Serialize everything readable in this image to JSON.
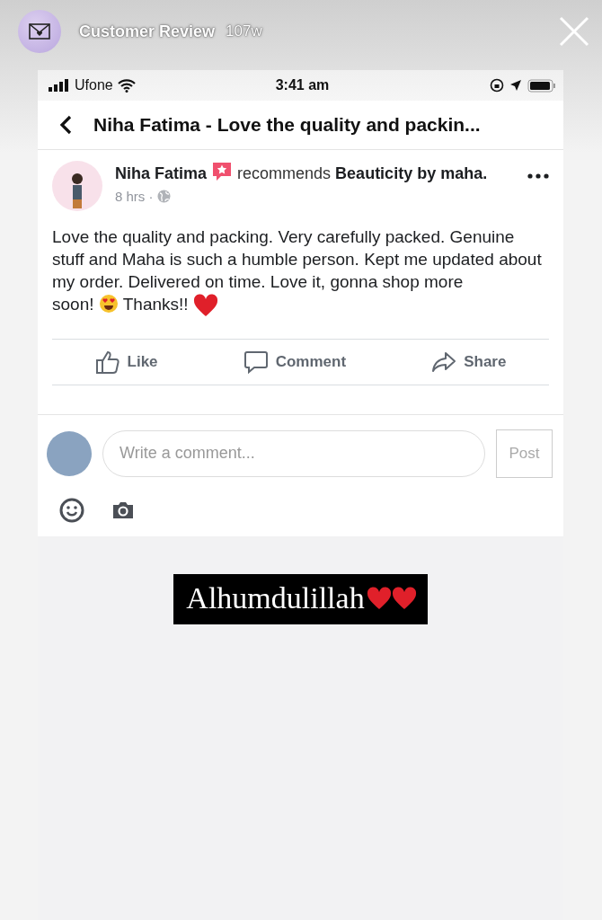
{
  "story": {
    "account_name": "Customer Review",
    "age": "107w"
  },
  "status_bar": {
    "carrier": "Ufone",
    "time": "3:41 am"
  },
  "nav": {
    "title": "Niha Fatima - Love the quality and packin..."
  },
  "post": {
    "author": "Niha Fatima",
    "verb_line": "recommends **Beauticity by maha.**",
    "time": "8 hrs ·",
    "body": "Love the quality and packing. Very carefully packed. Genuine stuff and Maha is such a humble person. Kept me updated about my order. Delivered on time. Love it, gonna shop more",
    "body_end": "soon!",
    "thanks": "Thanks!!"
  },
  "actions": [
    {
      "label": "Like",
      "kind": "like"
    },
    {
      "label": "Comment",
      "kind": "comment"
    },
    {
      "label": "Share",
      "kind": "share"
    }
  ],
  "comment_box": {
    "placeholder": "Write a comment...",
    "post_button": "Post"
  },
  "caption": {
    "text": "Alhumdulillah"
  }
}
